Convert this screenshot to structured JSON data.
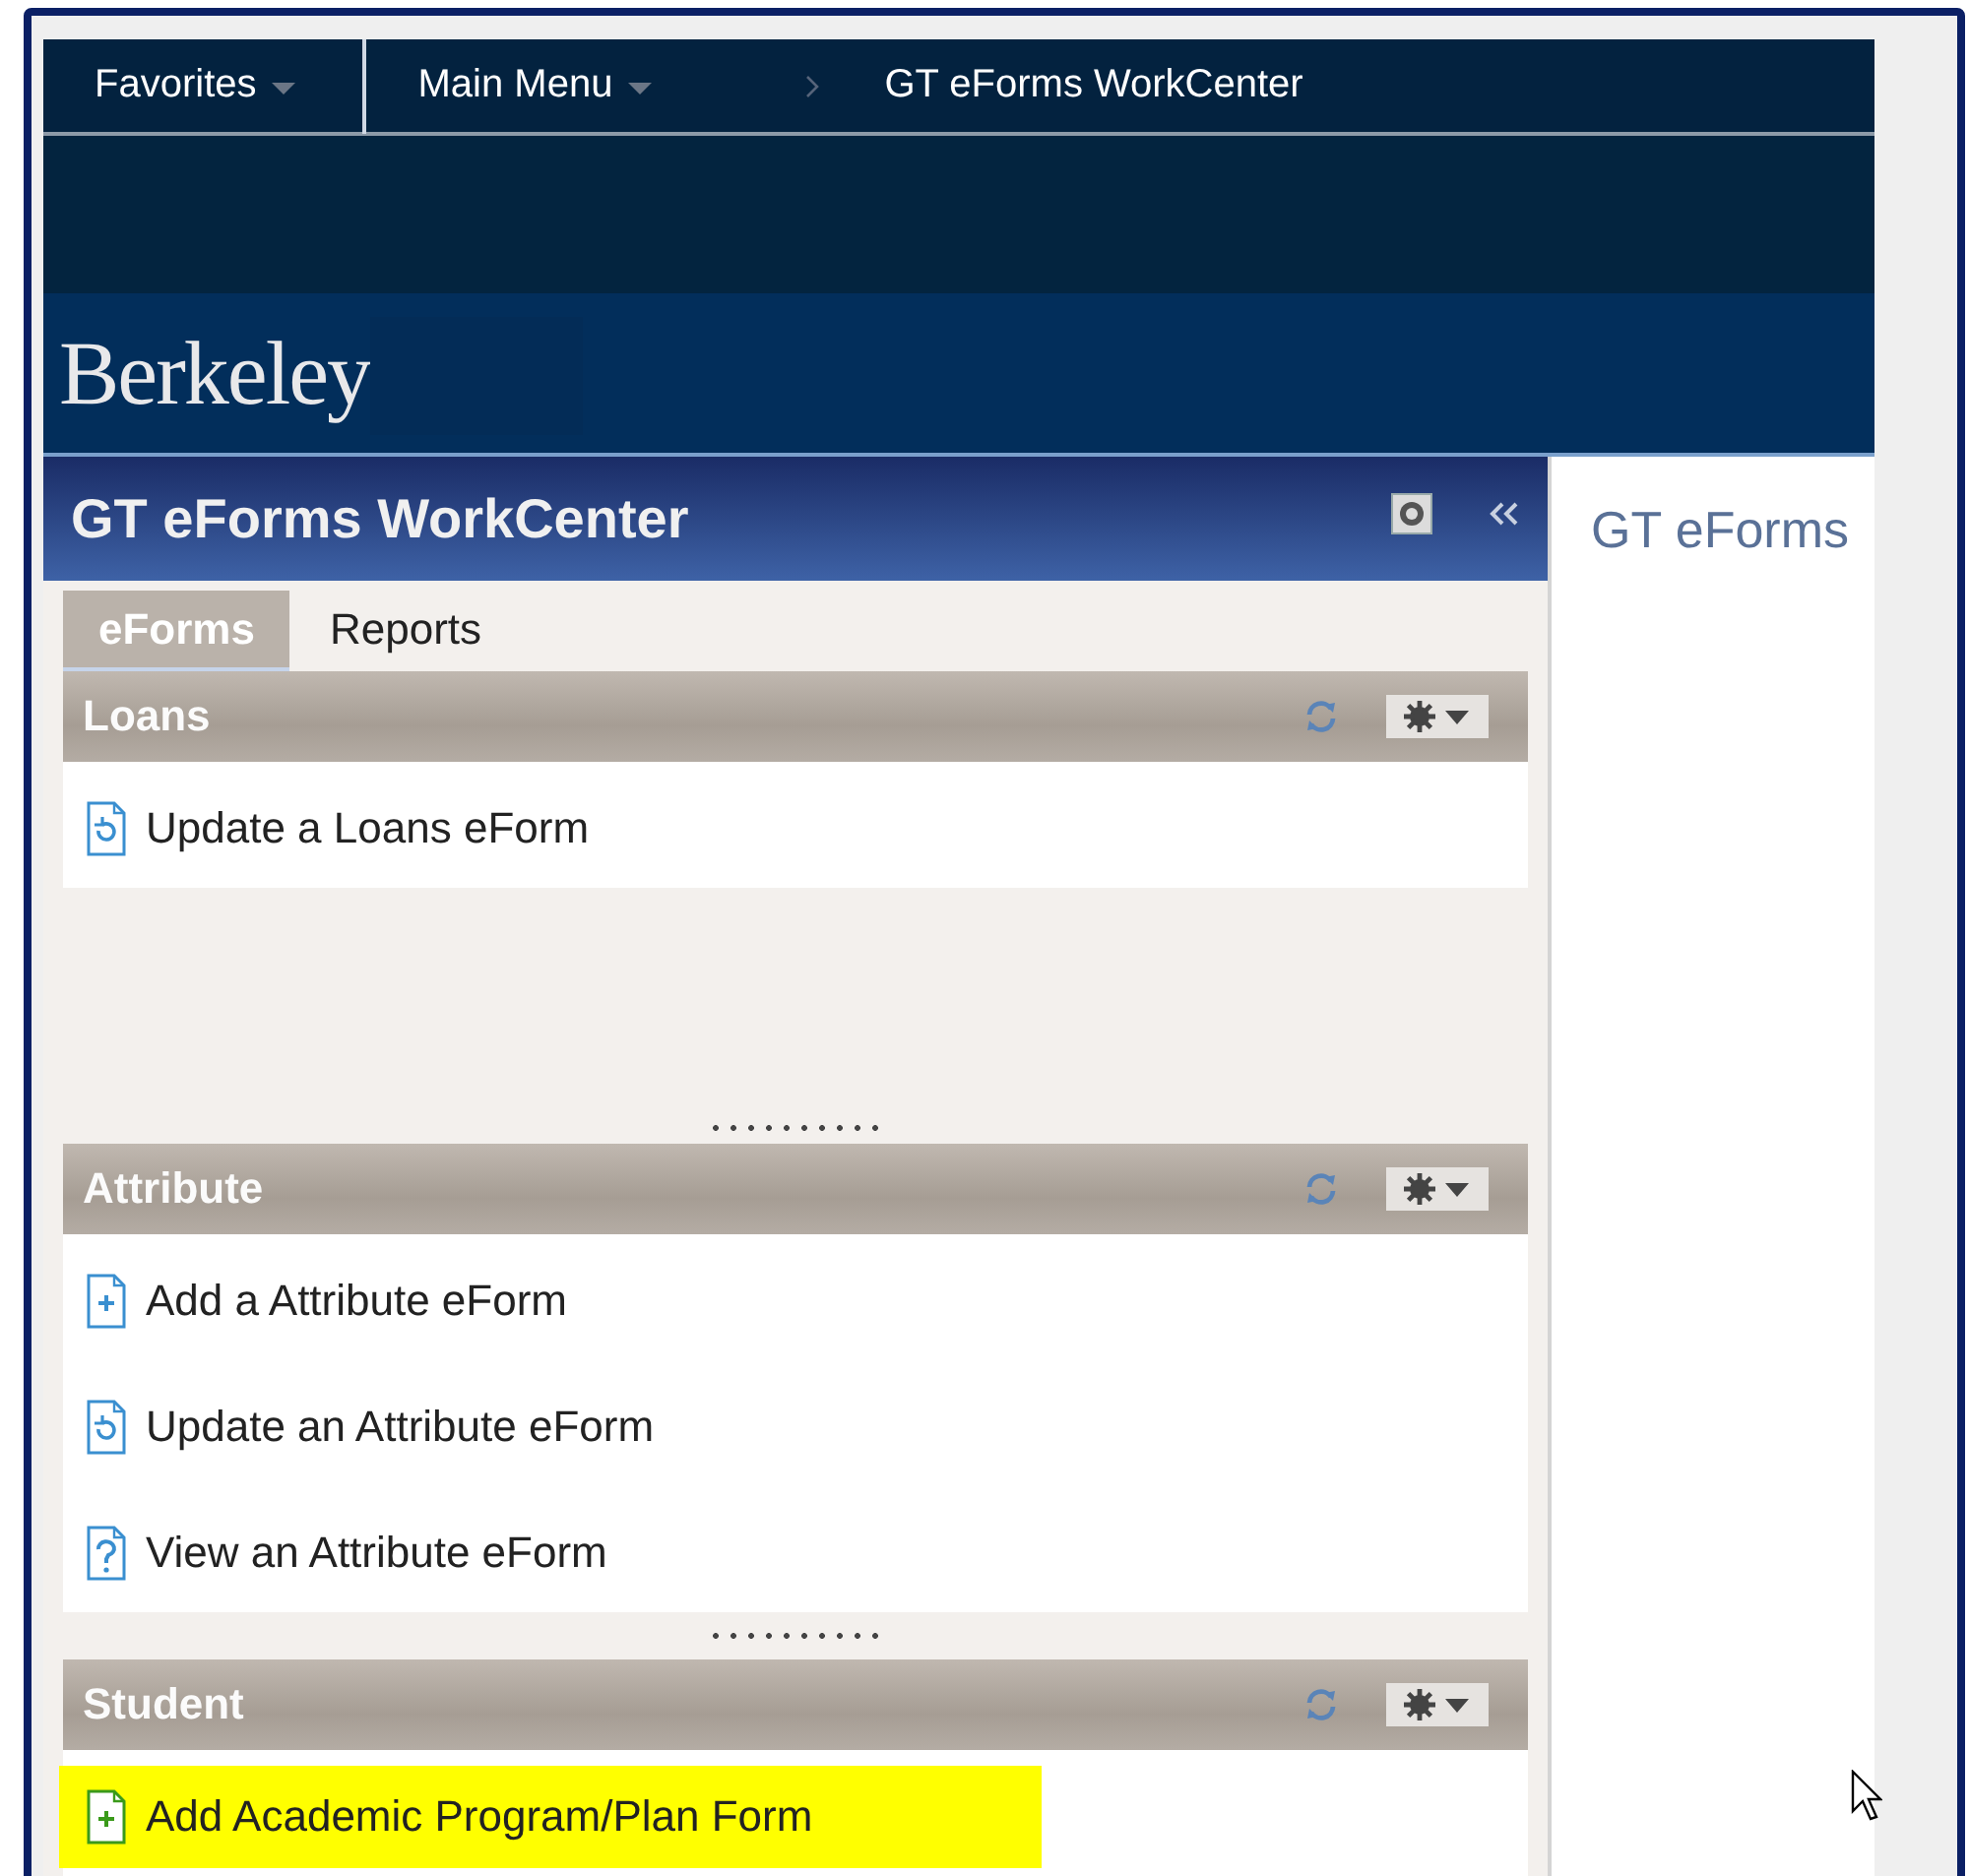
{
  "nav": {
    "items": [
      {
        "label": "Favorites",
        "dropdown": true
      },
      {
        "label": "Main Menu",
        "dropdown": true
      }
    ],
    "breadcrumb": "GT eForms WorkCenter"
  },
  "brand": {
    "logo_text": "Berkeley"
  },
  "workcenter": {
    "title": "GT eForms WorkCenter",
    "tabs": [
      {
        "label": "eForms",
        "selected": true
      },
      {
        "label": "Reports",
        "selected": false
      }
    ],
    "sections": [
      {
        "title": "Loans",
        "items": [
          {
            "label": "Update a Loans eForm",
            "kind": "update",
            "highlighted": false
          }
        ]
      },
      {
        "title": "Attribute",
        "items": [
          {
            "label": "Add a Attribute eForm",
            "kind": "add",
            "highlighted": false
          },
          {
            "label": "Update an Attribute eForm",
            "kind": "update",
            "highlighted": false
          },
          {
            "label": "View an Attribute eForm",
            "kind": "view",
            "highlighted": false
          }
        ]
      },
      {
        "title": "Student",
        "items": [
          {
            "label": "Add Academic Program/Plan Form",
            "kind": "add",
            "highlighted": true
          }
        ]
      }
    ]
  },
  "content": {
    "title": "GT eForms"
  }
}
